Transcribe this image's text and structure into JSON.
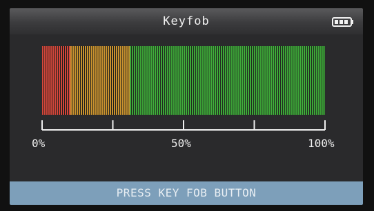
{
  "header": {
    "title": "Keyfob",
    "battery_icon": "battery-icon"
  },
  "signal_meter": {
    "level_percent": 100,
    "zones": [
      {
        "name": "low",
        "from": 0,
        "to": 10,
        "color": "#d2463a"
      },
      {
        "name": "mid",
        "from": 10,
        "to": 31,
        "color": "#c8922e"
      },
      {
        "name": "high",
        "from": 31,
        "to": 100,
        "color": "#3fae3a"
      }
    ]
  },
  "scale": {
    "labels": [
      "0%",
      "50%",
      "100%"
    ]
  },
  "footer": {
    "prompt": "PRESS KEY FOB BUTTON"
  },
  "colors": {
    "title_bar": "#3c3c3e",
    "screen_bg": "#2a2a2c",
    "footer_bar": "#7d9fba"
  }
}
